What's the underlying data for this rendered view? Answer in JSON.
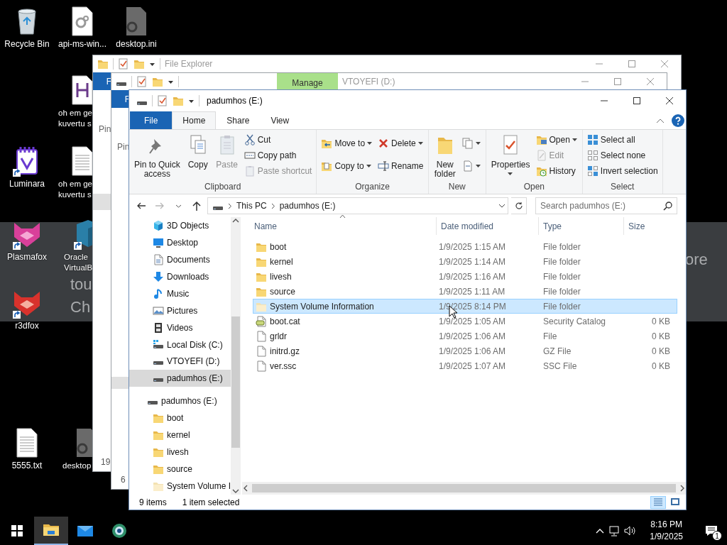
{
  "desktop_icons": [
    {
      "label": "Recycle Bin",
      "kind": "recycle",
      "shortcut": false
    },
    {
      "label": "api-ms-win...",
      "kind": "settings-file",
      "shortcut": false
    },
    {
      "label": "desktop.ini",
      "kind": "settings-file-dark",
      "shortcut": false
    },
    {
      "label": "oh em ge\nkuvertu s",
      "kind": "h-file",
      "shortcut": false
    },
    {
      "label": "Luminara",
      "kind": "notebook-app",
      "shortcut": true
    },
    {
      "label": "oh em ge\nkuvertu s",
      "kind": "text-file",
      "shortcut": false
    },
    {
      "label": "Plasmafox",
      "kind": "fox-pink",
      "shortcut": true
    },
    {
      "label": "Oracle\nVirtualB",
      "kind": "box-app",
      "shortcut": true
    },
    {
      "label": "r3dfox",
      "kind": "fox-red",
      "shortcut": true
    },
    {
      "label": "5555.txt",
      "kind": "text-file",
      "shortcut": false
    },
    {
      "label": "desktop",
      "kind": "settings-file-dark",
      "shortcut": false
    }
  ],
  "background_window": {
    "texts": [
      "tou",
      "Ch",
      "ore"
    ]
  },
  "back_windows": [
    {
      "title": "File Explorer",
      "file_tab": "F",
      "ribbon_text": "Pin",
      "status_text": "19"
    },
    {
      "title": "VTOYEFI (D:)",
      "context_tab": "Manage",
      "file_tab": "F",
      "ribbon_text": "Pin",
      "status_text": "6"
    }
  ],
  "window": {
    "title": "padumhos (E:)",
    "tabs": [
      {
        "label": "File",
        "kind": "file",
        "selected": false
      },
      {
        "label": "Home",
        "kind": "tab",
        "selected": true
      },
      {
        "label": "Share",
        "kind": "tab",
        "selected": false
      },
      {
        "label": "View",
        "kind": "tab",
        "selected": false
      }
    ],
    "ribbon": [
      {
        "label": "Clipboard",
        "items": [
          {
            "kind": "pin",
            "label": "Pin to Quick\naccess",
            "disabled": false,
            "dropdown": false
          },
          {
            "kind": "copy",
            "label": "Copy",
            "disabled": false,
            "dropdown": false
          },
          {
            "kind": "paste",
            "label": "Paste",
            "disabled": true,
            "dropdown": false
          },
          {
            "items": [
              {
                "kind": "cut",
                "label": "Cut",
                "disabled": false,
                "dropdown": false
              },
              {
                "kind": "copy-path",
                "label": "Copy path",
                "disabled": false,
                "dropdown": false
              },
              {
                "kind": "paste-shortcut",
                "label": "Paste shortcut",
                "disabled": true,
                "dropdown": false
              }
            ]
          }
        ]
      },
      {
        "label": "Organize",
        "items": [
          {
            "items": [
              {
                "kind": "move",
                "label": "Move to",
                "disabled": false,
                "dropdown": true
              },
              {
                "kind": "copy-to",
                "label": "Copy to",
                "disabled": false,
                "dropdown": true
              }
            ]
          },
          {
            "items": [
              {
                "kind": "delete",
                "label": "Delete",
                "disabled": false,
                "dropdown": true
              },
              {
                "kind": "rename",
                "label": "Rename",
                "disabled": false,
                "dropdown": false
              }
            ]
          }
        ]
      },
      {
        "label": "New",
        "items": [
          {
            "kind": "folder",
            "label": "New\nfolder",
            "disabled": false,
            "dropdown": false
          },
          {
            "items": [
              {
                "kind": "new-item",
                "disabled": false,
                "dropdown": true
              },
              {
                "kind": "easy-access",
                "disabled": false,
                "dropdown": true
              }
            ]
          }
        ]
      },
      {
        "label": "Open",
        "items": [
          {
            "kind": "properties",
            "label": "Properties",
            "disabled": false,
            "dropdown": true
          },
          {
            "items": [
              {
                "kind": "open",
                "label": "Open",
                "disabled": false,
                "dropdown": true
              },
              {
                "kind": "edit",
                "label": "Edit",
                "disabled": true,
                "dropdown": false
              },
              {
                "kind": "history",
                "label": "History",
                "disabled": false,
                "dropdown": false
              }
            ]
          }
        ]
      },
      {
        "label": "Select",
        "items": [
          {
            "items": [
              {
                "kind": "select-all",
                "label": "Select all",
                "disabled": false,
                "dropdown": false
              },
              {
                "kind": "select-none",
                "label": "Select none",
                "disabled": false,
                "dropdown": false
              },
              {
                "kind": "invert",
                "label": "Invert selection",
                "disabled": false,
                "dropdown": false
              }
            ]
          }
        ]
      }
    ],
    "address": {
      "segments": [
        "This PC",
        "padumhos (E:)"
      ],
      "search_placeholder": "Search padumhos (E:)"
    },
    "nav_pane": {
      "items": [
        {
          "label": "3D Objects",
          "kind": "cube",
          "selected": false
        },
        {
          "label": "Desktop",
          "kind": "desktop",
          "selected": false
        },
        {
          "label": "Documents",
          "kind": "document",
          "selected": false
        },
        {
          "label": "Downloads",
          "kind": "download",
          "selected": false
        },
        {
          "label": "Music",
          "kind": "music",
          "selected": false
        },
        {
          "label": "Pictures",
          "kind": "pictures",
          "selected": false
        },
        {
          "label": "Videos",
          "kind": "video",
          "selected": false
        },
        {
          "label": "Local Disk (C:)",
          "kind": "system-drive",
          "selected": false
        },
        {
          "label": "VTOYEFI (D:)",
          "kind": "drive",
          "selected": false
        },
        {
          "label": "padumhos (E:)",
          "kind": "drive",
          "selected": true
        }
      ],
      "tree": [
        {
          "label": "padumhos (E:)",
          "kind": "drive",
          "children": [
            {
              "label": "boot",
              "kind": "folder"
            },
            {
              "label": "kernel",
              "kind": "folder"
            },
            {
              "label": "livesh",
              "kind": "folder"
            },
            {
              "label": "source",
              "kind": "folder"
            },
            {
              "label": "System Volume I",
              "kind": "folder-hidden"
            }
          ]
        }
      ]
    },
    "columns": [
      {
        "label": "Name",
        "sorted": true
      },
      {
        "label": "Date modified",
        "sorted": false
      },
      {
        "label": "Type",
        "sorted": false
      },
      {
        "label": "Size",
        "sorted": false
      }
    ],
    "files": [
      {
        "name": "boot",
        "kind": "folder",
        "date": "1/9/2025 1:15 AM",
        "type": "File folder",
        "selected": false
      },
      {
        "name": "kernel",
        "kind": "folder",
        "date": "1/9/2025 1:14 AM",
        "type": "File folder",
        "selected": false
      },
      {
        "name": "livesh",
        "kind": "folder",
        "date": "1/9/2025 1:16 AM",
        "type": "File folder",
        "selected": false
      },
      {
        "name": "source",
        "kind": "folder",
        "date": "1/9/2025 1:11 AM",
        "type": "File folder",
        "selected": false
      },
      {
        "name": "System Volume Information",
        "kind": "folder-hidden",
        "date": "1/9/2025 8:14 PM",
        "type": "File folder",
        "selected": true
      },
      {
        "name": "boot.cat",
        "kind": "catalog",
        "date": "1/9/2025 1:05 AM",
        "type": "Security Catalog",
        "size": "0 KB",
        "selected": false
      },
      {
        "name": "grldr",
        "kind": "file",
        "date": "1/9/2025 1:06 AM",
        "type": "File",
        "size": "0 KB",
        "selected": false
      },
      {
        "name": "initrd.gz",
        "kind": "file",
        "date": "1/9/2025 1:06 AM",
        "type": "GZ File",
        "size": "0 KB",
        "selected": false
      },
      {
        "name": "ver.ssc",
        "kind": "file",
        "date": "1/9/2025 1:07 AM",
        "type": "SSC File",
        "size": "0 KB",
        "selected": false
      }
    ],
    "status": {
      "count": "9 items",
      "selection": "1 item selected",
      "views": [
        {
          "kind": "details",
          "selected": true
        },
        {
          "kind": "large-icons",
          "selected": false
        }
      ]
    }
  },
  "taskbar": {
    "apps": [
      {
        "kind": "file-explorer",
        "active": true
      },
      {
        "kind": "mail",
        "active": false
      },
      {
        "kind": "globe",
        "active": false
      }
    ],
    "time": "8:16 PM",
    "date": "1/9/2025",
    "notification_count": "1"
  }
}
